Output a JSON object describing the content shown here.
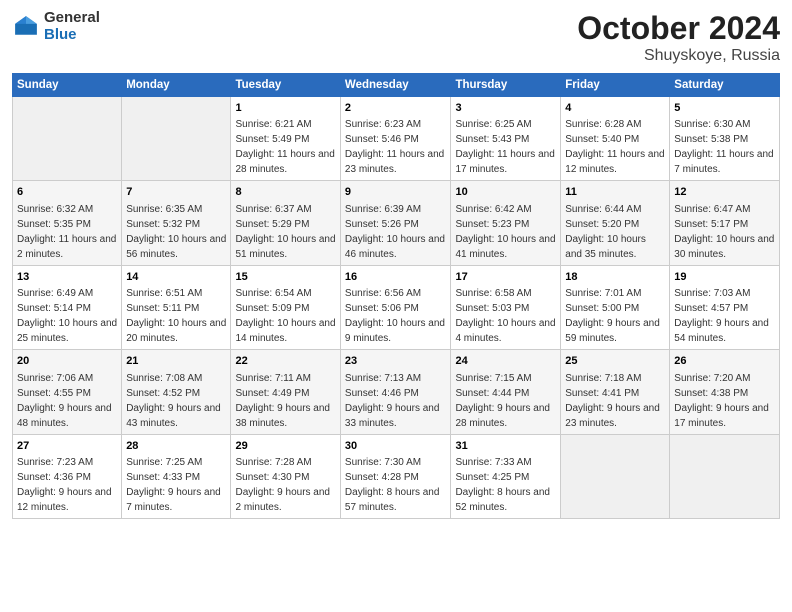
{
  "logo": {
    "general": "General",
    "blue": "Blue"
  },
  "header": {
    "month": "October 2024",
    "location": "Shuyskoye, Russia"
  },
  "weekdays": [
    "Sunday",
    "Monday",
    "Tuesday",
    "Wednesday",
    "Thursday",
    "Friday",
    "Saturday"
  ],
  "weeks": [
    [
      {
        "day": "",
        "sunrise": "",
        "sunset": "",
        "daylight": ""
      },
      {
        "day": "",
        "sunrise": "",
        "sunset": "",
        "daylight": ""
      },
      {
        "day": "1",
        "sunrise": "Sunrise: 6:21 AM",
        "sunset": "Sunset: 5:49 PM",
        "daylight": "Daylight: 11 hours and 28 minutes."
      },
      {
        "day": "2",
        "sunrise": "Sunrise: 6:23 AM",
        "sunset": "Sunset: 5:46 PM",
        "daylight": "Daylight: 11 hours and 23 minutes."
      },
      {
        "day": "3",
        "sunrise": "Sunrise: 6:25 AM",
        "sunset": "Sunset: 5:43 PM",
        "daylight": "Daylight: 11 hours and 17 minutes."
      },
      {
        "day": "4",
        "sunrise": "Sunrise: 6:28 AM",
        "sunset": "Sunset: 5:40 PM",
        "daylight": "Daylight: 11 hours and 12 minutes."
      },
      {
        "day": "5",
        "sunrise": "Sunrise: 6:30 AM",
        "sunset": "Sunset: 5:38 PM",
        "daylight": "Daylight: 11 hours and 7 minutes."
      }
    ],
    [
      {
        "day": "6",
        "sunrise": "Sunrise: 6:32 AM",
        "sunset": "Sunset: 5:35 PM",
        "daylight": "Daylight: 11 hours and 2 minutes."
      },
      {
        "day": "7",
        "sunrise": "Sunrise: 6:35 AM",
        "sunset": "Sunset: 5:32 PM",
        "daylight": "Daylight: 10 hours and 56 minutes."
      },
      {
        "day": "8",
        "sunrise": "Sunrise: 6:37 AM",
        "sunset": "Sunset: 5:29 PM",
        "daylight": "Daylight: 10 hours and 51 minutes."
      },
      {
        "day": "9",
        "sunrise": "Sunrise: 6:39 AM",
        "sunset": "Sunset: 5:26 PM",
        "daylight": "Daylight: 10 hours and 46 minutes."
      },
      {
        "day": "10",
        "sunrise": "Sunrise: 6:42 AM",
        "sunset": "Sunset: 5:23 PM",
        "daylight": "Daylight: 10 hours and 41 minutes."
      },
      {
        "day": "11",
        "sunrise": "Sunrise: 6:44 AM",
        "sunset": "Sunset: 5:20 PM",
        "daylight": "Daylight: 10 hours and 35 minutes."
      },
      {
        "day": "12",
        "sunrise": "Sunrise: 6:47 AM",
        "sunset": "Sunset: 5:17 PM",
        "daylight": "Daylight: 10 hours and 30 minutes."
      }
    ],
    [
      {
        "day": "13",
        "sunrise": "Sunrise: 6:49 AM",
        "sunset": "Sunset: 5:14 PM",
        "daylight": "Daylight: 10 hours and 25 minutes."
      },
      {
        "day": "14",
        "sunrise": "Sunrise: 6:51 AM",
        "sunset": "Sunset: 5:11 PM",
        "daylight": "Daylight: 10 hours and 20 minutes."
      },
      {
        "day": "15",
        "sunrise": "Sunrise: 6:54 AM",
        "sunset": "Sunset: 5:09 PM",
        "daylight": "Daylight: 10 hours and 14 minutes."
      },
      {
        "day": "16",
        "sunrise": "Sunrise: 6:56 AM",
        "sunset": "Sunset: 5:06 PM",
        "daylight": "Daylight: 10 hours and 9 minutes."
      },
      {
        "day": "17",
        "sunrise": "Sunrise: 6:58 AM",
        "sunset": "Sunset: 5:03 PM",
        "daylight": "Daylight: 10 hours and 4 minutes."
      },
      {
        "day": "18",
        "sunrise": "Sunrise: 7:01 AM",
        "sunset": "Sunset: 5:00 PM",
        "daylight": "Daylight: 9 hours and 59 minutes."
      },
      {
        "day": "19",
        "sunrise": "Sunrise: 7:03 AM",
        "sunset": "Sunset: 4:57 PM",
        "daylight": "Daylight: 9 hours and 54 minutes."
      }
    ],
    [
      {
        "day": "20",
        "sunrise": "Sunrise: 7:06 AM",
        "sunset": "Sunset: 4:55 PM",
        "daylight": "Daylight: 9 hours and 48 minutes."
      },
      {
        "day": "21",
        "sunrise": "Sunrise: 7:08 AM",
        "sunset": "Sunset: 4:52 PM",
        "daylight": "Daylight: 9 hours and 43 minutes."
      },
      {
        "day": "22",
        "sunrise": "Sunrise: 7:11 AM",
        "sunset": "Sunset: 4:49 PM",
        "daylight": "Daylight: 9 hours and 38 minutes."
      },
      {
        "day": "23",
        "sunrise": "Sunrise: 7:13 AM",
        "sunset": "Sunset: 4:46 PM",
        "daylight": "Daylight: 9 hours and 33 minutes."
      },
      {
        "day": "24",
        "sunrise": "Sunrise: 7:15 AM",
        "sunset": "Sunset: 4:44 PM",
        "daylight": "Daylight: 9 hours and 28 minutes."
      },
      {
        "day": "25",
        "sunrise": "Sunrise: 7:18 AM",
        "sunset": "Sunset: 4:41 PM",
        "daylight": "Daylight: 9 hours and 23 minutes."
      },
      {
        "day": "26",
        "sunrise": "Sunrise: 7:20 AM",
        "sunset": "Sunset: 4:38 PM",
        "daylight": "Daylight: 9 hours and 17 minutes."
      }
    ],
    [
      {
        "day": "27",
        "sunrise": "Sunrise: 7:23 AM",
        "sunset": "Sunset: 4:36 PM",
        "daylight": "Daylight: 9 hours and 12 minutes."
      },
      {
        "day": "28",
        "sunrise": "Sunrise: 7:25 AM",
        "sunset": "Sunset: 4:33 PM",
        "daylight": "Daylight: 9 hours and 7 minutes."
      },
      {
        "day": "29",
        "sunrise": "Sunrise: 7:28 AM",
        "sunset": "Sunset: 4:30 PM",
        "daylight": "Daylight: 9 hours and 2 minutes."
      },
      {
        "day": "30",
        "sunrise": "Sunrise: 7:30 AM",
        "sunset": "Sunset: 4:28 PM",
        "daylight": "Daylight: 8 hours and 57 minutes."
      },
      {
        "day": "31",
        "sunrise": "Sunrise: 7:33 AM",
        "sunset": "Sunset: 4:25 PM",
        "daylight": "Daylight: 8 hours and 52 minutes."
      },
      {
        "day": "",
        "sunrise": "",
        "sunset": "",
        "daylight": ""
      },
      {
        "day": "",
        "sunrise": "",
        "sunset": "",
        "daylight": ""
      }
    ]
  ]
}
